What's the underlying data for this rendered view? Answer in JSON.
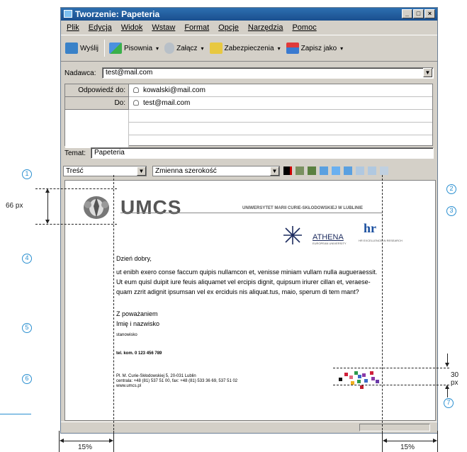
{
  "window": {
    "title": "Tworzenie: Papeteria",
    "controls": [
      "_",
      "□",
      "×"
    ]
  },
  "menu": [
    "Plik",
    "Edycja",
    "Widok",
    "Wstaw",
    "Format",
    "Opcje",
    "Narzędzia",
    "Pomoc"
  ],
  "toolbar": {
    "send": "Wyślij",
    "spelling": "Pisownia",
    "attach": "Załącz",
    "security": "Zabezpieczenia",
    "save_as": "Zapisz jako"
  },
  "header": {
    "sender_label": "Nadawca:",
    "sender_value": "test@mail.com",
    "reply_label": "Odpowiedź do:",
    "reply_value": "kowalski@mail.com",
    "to_label": "Do:",
    "to_value": "test@mail.com",
    "subject_label": "Temat:",
    "subject_value": "Papeteria"
  },
  "format_bar": {
    "style": "Treść",
    "font": "Zmienna szerokość"
  },
  "email": {
    "logo_text": "UMCS",
    "university": "UNIWERSYTET MARII CURIE-SKŁODOWSKIEJ W LUBLINIE",
    "athena": "ATHENA",
    "athena_sub": "EUROPEAN UNIVERSITY",
    "hr_logo": "hr",
    "hr_sub": "HR EXCELLENCE IN RESEARCH",
    "greeting": "Dzień dobry,",
    "body1": "ut enibh exero conse faccum quipis nullamcon et, venisse miniam vullam nulla augueraessit.",
    "body2": "Ut eum quisl duipit iure feuis aliquamet vel ercipis dignit, quipsum iriurer cillan et, veraese-",
    "body3": "quam zzrit adignit ipsumsan vel ex erciduis nis aliquat.tus, maio, sperum di tem mant?",
    "closing": "Z poważaniem",
    "name": "Imię i nazwisko",
    "position": "stanowisko",
    "phone": "tel. kom. 0 123 456 789",
    "address": "Pl. M. Curie-Skłodowskiej 5, 20-031 Lublin",
    "switchboard": "centrala: +48 (81) 537 51 00, fax: +48 (81) 533 36 69, 537 51 02",
    "web": "www.umcs.pl"
  },
  "annotations": {
    "n1": "1",
    "n2": "2",
    "n3": "3",
    "n4": "4",
    "n5": "5",
    "n6": "6",
    "n7": "7",
    "size_66": "66 px",
    "size_30": "30 px",
    "pct_left": "15%",
    "pct_right": "15%"
  },
  "colors": {
    "titlebar": "#1a4f8f",
    "chrome": "#d4d0c8",
    "guide_accent": "#2a8fd0"
  }
}
